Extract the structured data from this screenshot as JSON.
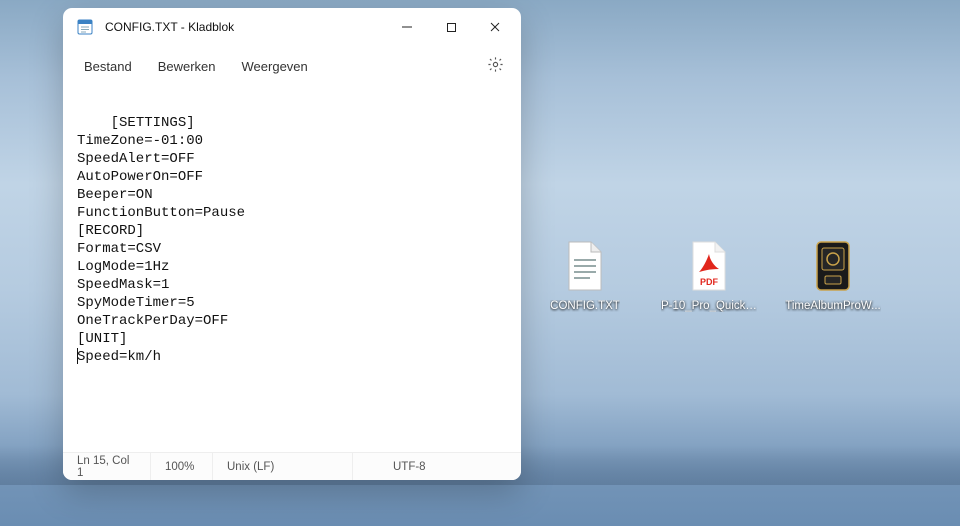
{
  "window": {
    "title": "CONFIG.TXT - Kladblok",
    "menus": {
      "file": "Bestand",
      "edit": "Bewerken",
      "view": "Weergeven"
    }
  },
  "editor": {
    "content": "[SETTINGS]\nTimeZone=-01:00\nSpeedAlert=OFF\nAutoPowerOn=OFF\nBeeper=ON\nFunctionButton=Pause\n[RECORD]\nFormat=CSV\nLogMode=1Hz\nSpeedMask=1\nSpyModeTimer=5\nOneTrackPerDay=OFF\n[UNIT]\nSpeed=km/h"
  },
  "statusbar": {
    "position": "Ln 15, Col 1",
    "zoom": "100%",
    "line_ending": "Unix (LF)",
    "encoding": "UTF-8"
  },
  "desktop": {
    "icons": [
      {
        "label": "CONFIG.TXT"
      },
      {
        "label": "P-10_Pro_Quickst..."
      },
      {
        "label": "TimeAlbumProW..."
      }
    ]
  }
}
